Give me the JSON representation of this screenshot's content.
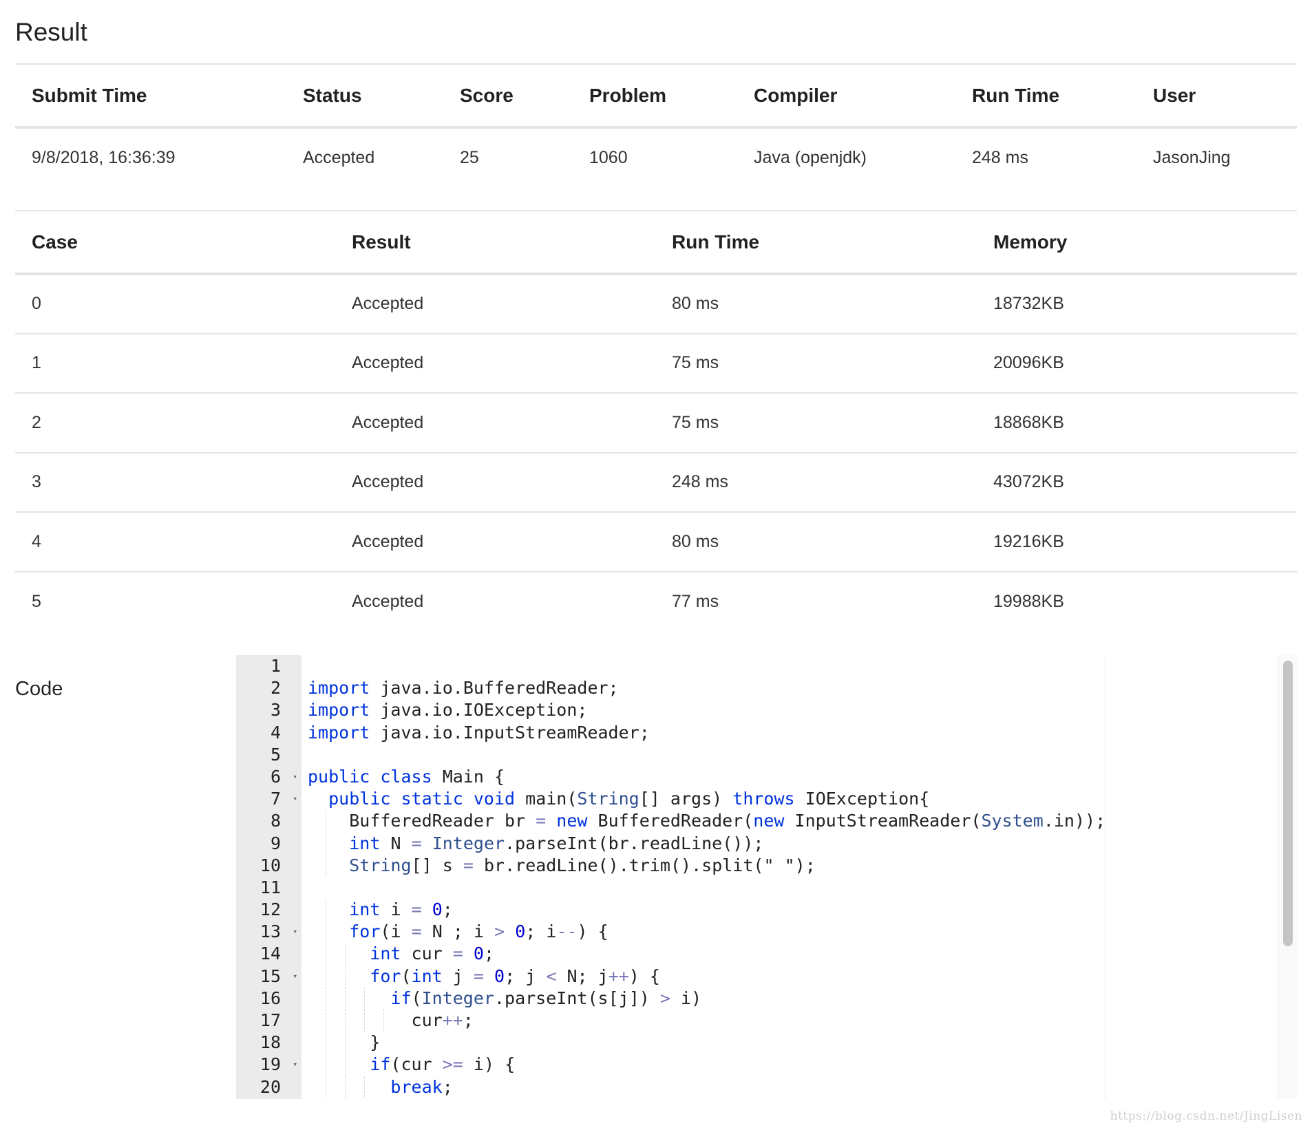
{
  "page": {
    "title": "Result"
  },
  "submission": {
    "headers": [
      "Submit Time",
      "Status",
      "Score",
      "Problem",
      "Compiler",
      "Run Time",
      "User"
    ],
    "row": {
      "submit_time": "9/8/2018, 16:36:39",
      "status": "Accepted",
      "score": "25",
      "problem": "1060",
      "compiler": "Java (openjdk)",
      "run_time": "248 ms",
      "user": "JasonJing"
    }
  },
  "cases": {
    "headers": [
      "Case",
      "Result",
      "Run Time",
      "Memory"
    ],
    "rows": [
      {
        "case": "0",
        "result": "Accepted",
        "run_time": "80 ms",
        "memory": "18732KB"
      },
      {
        "case": "1",
        "result": "Accepted",
        "run_time": "75 ms",
        "memory": "20096KB"
      },
      {
        "case": "2",
        "result": "Accepted",
        "run_time": "75 ms",
        "memory": "18868KB"
      },
      {
        "case": "3",
        "result": "Accepted",
        "run_time": "248 ms",
        "memory": "43072KB"
      },
      {
        "case": "4",
        "result": "Accepted",
        "run_time": "80 ms",
        "memory": "19216KB"
      },
      {
        "case": "5",
        "result": "Accepted",
        "run_time": "77 ms",
        "memory": "19988KB"
      }
    ]
  },
  "code": {
    "label": "Code",
    "line_numbers": [
      "1",
      "2",
      "3",
      "4",
      "5",
      "6",
      "7",
      "8",
      "9",
      "10",
      "11",
      "12",
      "13",
      "14",
      "15",
      "16",
      "17",
      "18",
      "19",
      "20"
    ],
    "lines": [
      "",
      "import java.io.BufferedReader;",
      "import java.io.IOException;",
      "import java.io.InputStreamReader;",
      "",
      "public class Main {",
      "  public static void main(String[] args) throws IOException{",
      "    BufferedReader br = new BufferedReader(new InputStreamReader(System.in));",
      "    int N = Integer.parseInt(br.readLine());",
      "    String[] s = br.readLine().trim().split(\" \");",
      "",
      "    int i = 0;",
      "    for(i = N ; i > 0; i--) {",
      "      int cur = 0;",
      "      for(int j = 0; j < N; j++) {",
      "        if(Integer.parseInt(s[j]) > i)",
      "          cur++;",
      "      }",
      "      if(cur >= i) {",
      "        break;"
    ],
    "fold_lines": [
      "6",
      "7",
      "13",
      "15",
      "19"
    ]
  },
  "colors": {
    "accepted": "#e64a3b",
    "link": "#1d4f91",
    "keyword": "#0033dd"
  },
  "watermark": "https://blog.csdn.net/JingLisen"
}
